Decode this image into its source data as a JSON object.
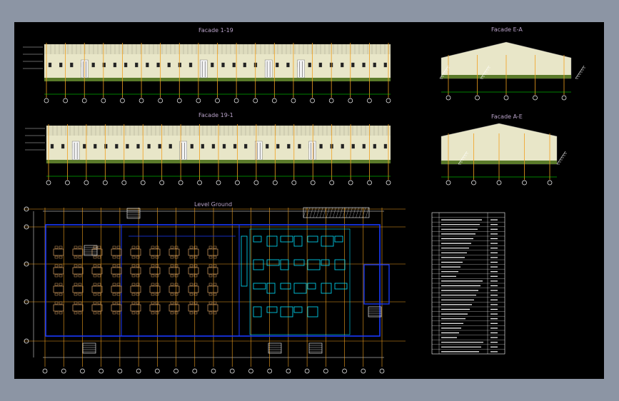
{
  "canvas": {
    "background": "#000000",
    "frame": "#8c95a4"
  },
  "drawings": {
    "facade_1_19": {
      "title": "Facade 1-19",
      "axis_count": 19
    },
    "facade_e_a": {
      "title": "Facade E-A",
      "axis_count": 5
    },
    "facade_19_1": {
      "title": "Facade 19-1",
      "axis_count": 19
    },
    "facade_a_e": {
      "title": "Facade A-E",
      "axis_count": 5
    },
    "plan": {
      "title": "Level Ground",
      "axis_count": 19,
      "row_count": 5
    }
  },
  "legend": {
    "rows": 30
  },
  "colors": {
    "wall": "#e8e6c8",
    "roof": "#dedcbe",
    "plinth": "#5a7a2a",
    "axis": "#f0a020",
    "dim": "#00ff00",
    "plan_wall": "#1a3aff",
    "furniture": "#d8a060",
    "equipment": "#00e0ff",
    "white": "#ffffff",
    "title": "#b9a3c9"
  }
}
